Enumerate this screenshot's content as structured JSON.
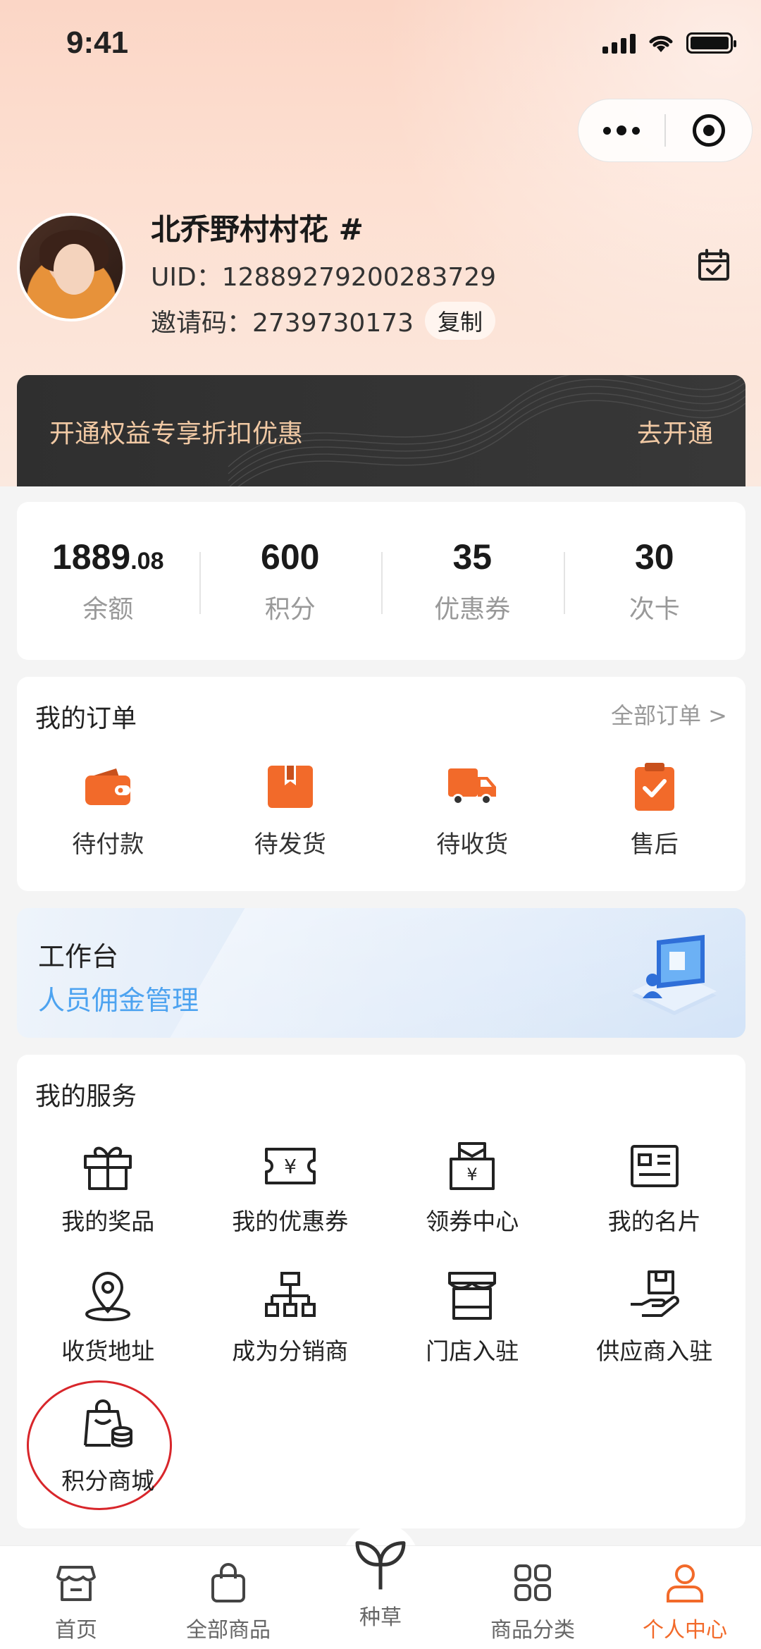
{
  "status_bar": {
    "time": "9:41"
  },
  "profile": {
    "nickname": "北乔野村村花 #",
    "uid": "UID：12889279200283729",
    "invite_code": "邀请码：2739730173",
    "copy_label": "复制"
  },
  "vip_banner": {
    "title": "开通权益专享折扣优惠",
    "action": "去开通"
  },
  "stats": [
    {
      "value_int": "1889",
      "value_dec": ".08",
      "label": "余额"
    },
    {
      "value_int": "600",
      "value_dec": "",
      "label": "积分"
    },
    {
      "value_int": "35",
      "value_dec": "",
      "label": "优惠券"
    },
    {
      "value_int": "30",
      "value_dec": "",
      "label": "次卡"
    }
  ],
  "orders": {
    "title": "我的订单",
    "link": "全部订单 >",
    "items": [
      {
        "label": "待付款",
        "icon": "wallet-icon"
      },
      {
        "label": "待发货",
        "icon": "box-icon"
      },
      {
        "label": "待收货",
        "icon": "truck-icon"
      },
      {
        "label": "售后",
        "icon": "clipboard-check-icon"
      }
    ]
  },
  "workbench": {
    "title": "工作台",
    "subtitle": "人员佣金管理"
  },
  "services": {
    "title": "我的服务",
    "items": [
      {
        "label": "我的奖品",
        "icon": "gift-icon"
      },
      {
        "label": "我的优惠券",
        "icon": "coupon-icon"
      },
      {
        "label": "领券中心",
        "icon": "coupon-center-icon"
      },
      {
        "label": "我的名片",
        "icon": "card-icon"
      },
      {
        "label": "收货地址",
        "icon": "location-icon"
      },
      {
        "label": "成为分销商",
        "icon": "hierarchy-icon"
      },
      {
        "label": "门店入驻",
        "icon": "store-icon"
      },
      {
        "label": "供应商入驻",
        "icon": "supplier-icon"
      },
      {
        "label": "积分商城",
        "icon": "points-mall-icon"
      }
    ]
  },
  "tabbar": [
    {
      "label": "首页",
      "icon": "home-store-icon",
      "active": false
    },
    {
      "label": "全部商品",
      "icon": "bag-icon",
      "active": false
    },
    {
      "label": "种草",
      "icon": "sprout-icon",
      "active": false
    },
    {
      "label": "商品分类",
      "icon": "grid-icon",
      "active": false
    },
    {
      "label": "个人中心",
      "icon": "user-icon",
      "active": true
    }
  ],
  "colors": {
    "accent": "#f26a2a",
    "vip_text": "#f1c9a4",
    "link_blue": "#4da3f0"
  }
}
